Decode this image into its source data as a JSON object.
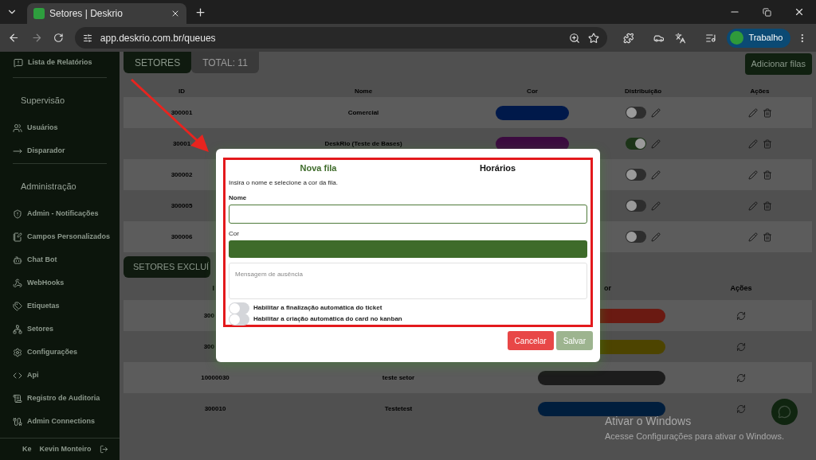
{
  "browser": {
    "tab": {
      "title": "Setores | Deskrio"
    },
    "url": "app.deskrio.com.br/queues",
    "profile": "Trabalho"
  },
  "sidebar": {
    "groups": [
      {
        "items": [
          "Lista de Relatórios"
        ]
      },
      {
        "heading": "Supervisão",
        "items": [
          "Usuários",
          "Disparador"
        ]
      },
      {
        "heading": "Administração",
        "items": [
          "Admin - Notificações",
          "Campos Personalizados",
          "Chat Bot",
          "WebHooks",
          "Etiquetas",
          "Setores",
          "Configurações",
          "Api",
          "Registro de Auditoria",
          "Admin Connections"
        ]
      }
    ],
    "user": {
      "initials": "Ke",
      "name": "Kevin Monteiro"
    }
  },
  "queues": {
    "tabs": [
      {
        "label": "SETORES",
        "selected": true
      },
      {
        "label": "TOTAL: 11",
        "selected": false
      }
    ],
    "add_button": "Adicionar filas",
    "columns": [
      "ID",
      "Nome",
      "Cor",
      "Distribuição",
      "Ações"
    ],
    "rows": [
      {
        "id": "300001",
        "name": "Comercial",
        "color": "#00194a",
        "distribution_on": false
      },
      {
        "id": "30001",
        "name": "DeskRio (Teste de Bases)",
        "color": "#3b0b3f",
        "distribution_on": true
      },
      {
        "id": "300002",
        "distribution_on": false
      },
      {
        "id": "300005",
        "distribution_on": false
      },
      {
        "id": "300006",
        "distribution_on": false
      }
    ]
  },
  "deleted": {
    "title": "SETORES EXCLUÍ",
    "column_1": "I",
    "column_3": "or",
    "column_4": "Ações",
    "rows": [
      {
        "id": "300",
        "color": "#6a1a12"
      },
      {
        "id": "300",
        "color": "#4d4400"
      },
      {
        "id": "10000030",
        "name": "teste setor",
        "color": "#1c1c1c"
      },
      {
        "id": "300010",
        "name": "Testetest",
        "color": "#001e3d"
      }
    ]
  },
  "modal": {
    "tabs": [
      {
        "label": "Nova fila",
        "selected": true
      },
      {
        "label": "Horários",
        "selected": false
      }
    ],
    "instruction": "Insira o nome e selecione a cor da fila.",
    "name_label": "Nome",
    "color_label": "Cor",
    "color": "#3e6b2a",
    "absence_placeholder": "Mensagem de ausência",
    "switches": [
      {
        "label": "Habilitar a finalização automática do ticket",
        "on": false
      },
      {
        "label": "Habilitar a criação automática do card no kanban",
        "on": false
      }
    ],
    "cancel": "Cancelar",
    "save": "Salvar",
    "save_disabled": true
  },
  "windows": {
    "title": "Ativar o Windows",
    "subtitle": "Acesse Configurações para ativar o Windows."
  }
}
